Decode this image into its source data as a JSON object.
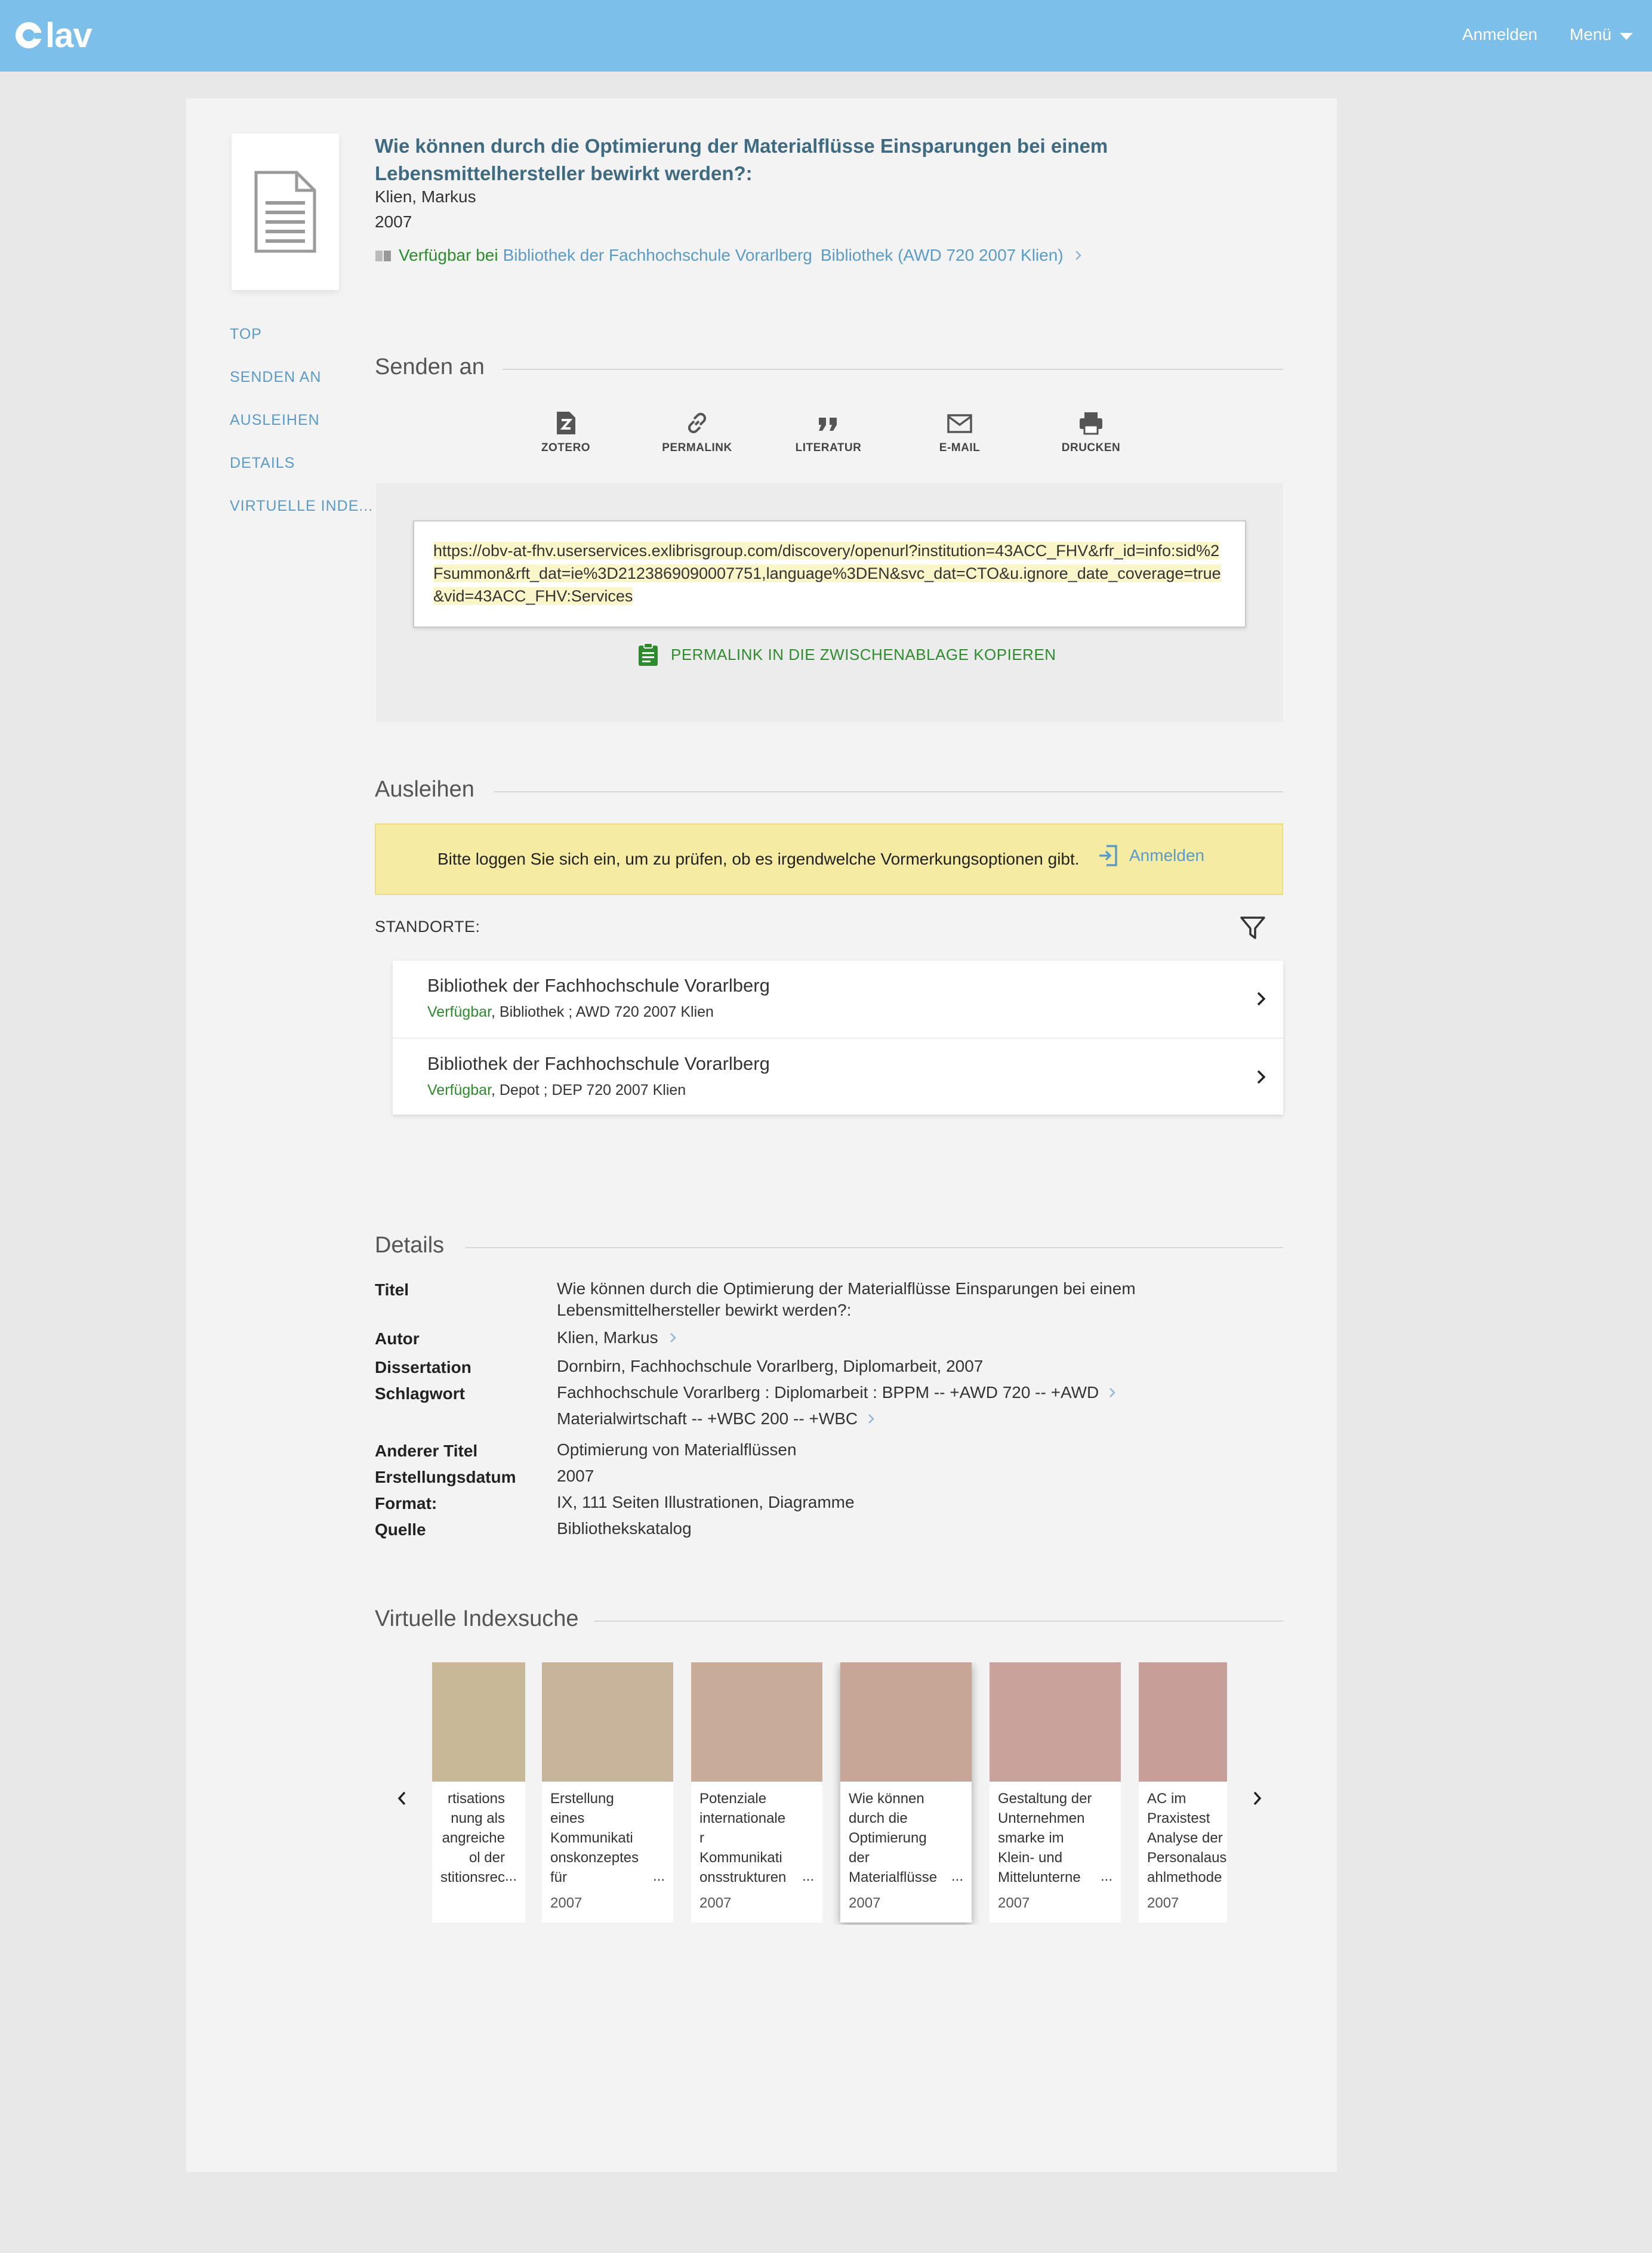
{
  "header": {
    "logo_text": "lav",
    "login_label": "Anmelden",
    "menu_label": "Menü"
  },
  "record": {
    "title": "Wie können durch die Optimierung der Materialflüsse Einsparungen bei einem Lebensmittelhersteller bewirkt werden?:",
    "author": "Klien, Markus",
    "year": "2007",
    "availability_status": "Verfügbar bei",
    "availability_library": "Bibliothek der Fachhochschule Vorarlberg",
    "availability_location": "Bibliothek (AWD 720 2007 Klien)"
  },
  "sidenav": {
    "items": [
      "TOP",
      "SENDEN AN",
      "AUSLEIHEN",
      "DETAILS",
      "VIRTUELLE INDE..."
    ]
  },
  "send": {
    "heading": "Senden an",
    "actions": [
      {
        "label": "ZOTERO",
        "icon": "zotero-icon"
      },
      {
        "label": "PERMALINK",
        "icon": "link-icon"
      },
      {
        "label": "LITERATUR",
        "icon": "quote-icon"
      },
      {
        "label": "E-MAIL",
        "icon": "mail-icon"
      },
      {
        "label": "DRUCKEN",
        "icon": "print-icon"
      }
    ],
    "permalink_url": "https://obv-at-fhv.userservices.exlibrisgroup.com/discovery/openurl?institution=43ACC_FHV&rfr_id=info:sid%2Fsummon&rft_dat=ie%3D2123869090007751,language%3DEN&svc_dat=CTO&u.ignore_date_coverage=true&vid=43ACC_FHV:Services",
    "copy_label": "PERMALINK IN DIE ZWISCHENABLAGE KOPIEREN"
  },
  "loan": {
    "heading": "Ausleihen",
    "login_message": "Bitte loggen Sie sich ein, um zu prüfen, ob es irgendwelche Vormerkungsoptionen gibt.",
    "login_link": "Anmelden",
    "locations_label": "STANDORTE:",
    "locations": [
      {
        "name": "Bibliothek der Fachhochschule Vorarlberg",
        "status": "Verfügbar",
        "detail": ", Bibliothek ; AWD 720 2007 Klien"
      },
      {
        "name": "Bibliothek der Fachhochschule Vorarlberg",
        "status": "Verfügbar",
        "detail": ", Depot ; DEP 720 2007 Klien"
      }
    ]
  },
  "details": {
    "heading": "Details",
    "rows": {
      "titel_label": "Titel",
      "titel_value": "Wie können durch die Optimierung der Materialflüsse Einsparungen bei einem Lebensmittelhersteller bewirkt werden?:",
      "autor_label": "Autor",
      "autor_value": "Klien, Markus",
      "dissertation_label": "Dissertation",
      "dissertation_value": "Dornbirn, Fachhochschule Vorarlberg, Diplomarbeit, 2007",
      "schlagwort_label": "Schlagwort",
      "schlagwort_value_1": "Fachhochschule Vorarlberg : Diplomarbeit : BPPM -- +AWD 720 -- +AWD",
      "schlagwort_value_2": "Materialwirtschaft -- +WBC 200 -- +WBC",
      "anderer_titel_label": "Anderer Titel",
      "anderer_titel_value": "Optimierung von Materialflüssen",
      "erstellungsdatum_label": "Erstellungsdatum",
      "erstellungsdatum_value": "2007",
      "format_label": "Format:",
      "format_value": "IX, 111 Seiten Illustrationen, Diagramme",
      "quelle_label": "Quelle",
      "quelle_value": "Bibliothekskatalog"
    }
  },
  "virtual_index": {
    "heading": "Virtuelle Indexsuche",
    "cards": [
      {
        "text": "rtisations\nnung als\nangreiche\nol der\nstitionsrec",
        "year": "",
        "color": "#c9b897"
      },
      {
        "text": "Erstellung\neines\nKommunikati\nonskonzeptes\nfür",
        "year": "2007",
        "color": "#c8b49a"
      },
      {
        "text": "Potenziale\ninternationale\nr\nKommunikati\nonsstrukturen",
        "year": "2007",
        "color": "#c8ab99"
      },
      {
        "text": "Wie können\ndurch die\nOptimierung\nder\nMaterialflüsse",
        "year": "2007",
        "color": "#c7a698"
      },
      {
        "text": "Gestaltung der\nUnternehmen\nsmarke im\nKlein- und\nMittelunterne",
        "year": "2007",
        "color": "#c9a39b"
      },
      {
        "text": "AC im\nPraxistest\nAnalyse der\nPersonalaus\nahlmethode",
        "year": "2007",
        "color": "#c89f98"
      }
    ]
  }
}
